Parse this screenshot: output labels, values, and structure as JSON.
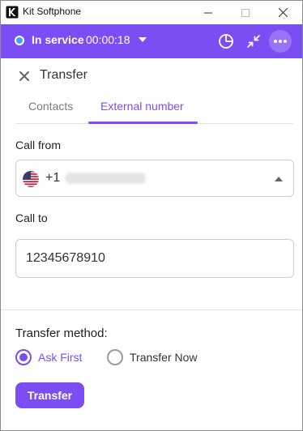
{
  "window": {
    "title": "Kit Softphone"
  },
  "status": {
    "label": "In service",
    "timer": "00:00:18"
  },
  "panel": {
    "title": "Transfer"
  },
  "tabs": [
    {
      "label": "Contacts",
      "active": false
    },
    {
      "label": "External number",
      "active": true
    }
  ],
  "call_from": {
    "label": "Call from",
    "country_code": "+1"
  },
  "call_to": {
    "label": "Call to",
    "value": "12345678910"
  },
  "transfer_method": {
    "label": "Transfer method:",
    "options": [
      {
        "label": "Ask First",
        "selected": true
      },
      {
        "label": "Transfer Now",
        "selected": false
      }
    ]
  },
  "actions": {
    "transfer_label": "Transfer"
  },
  "colors": {
    "accent": "#7b4ef3",
    "status_dot": "#3fa3ff"
  },
  "icons": [
    "softphone-app-icon",
    "minimize-icon",
    "maximize-icon",
    "close-icon",
    "chevron-down-icon",
    "pie-chart-icon",
    "collapse-icon",
    "more-icon",
    "close-x-icon",
    "us-flag-icon"
  ]
}
